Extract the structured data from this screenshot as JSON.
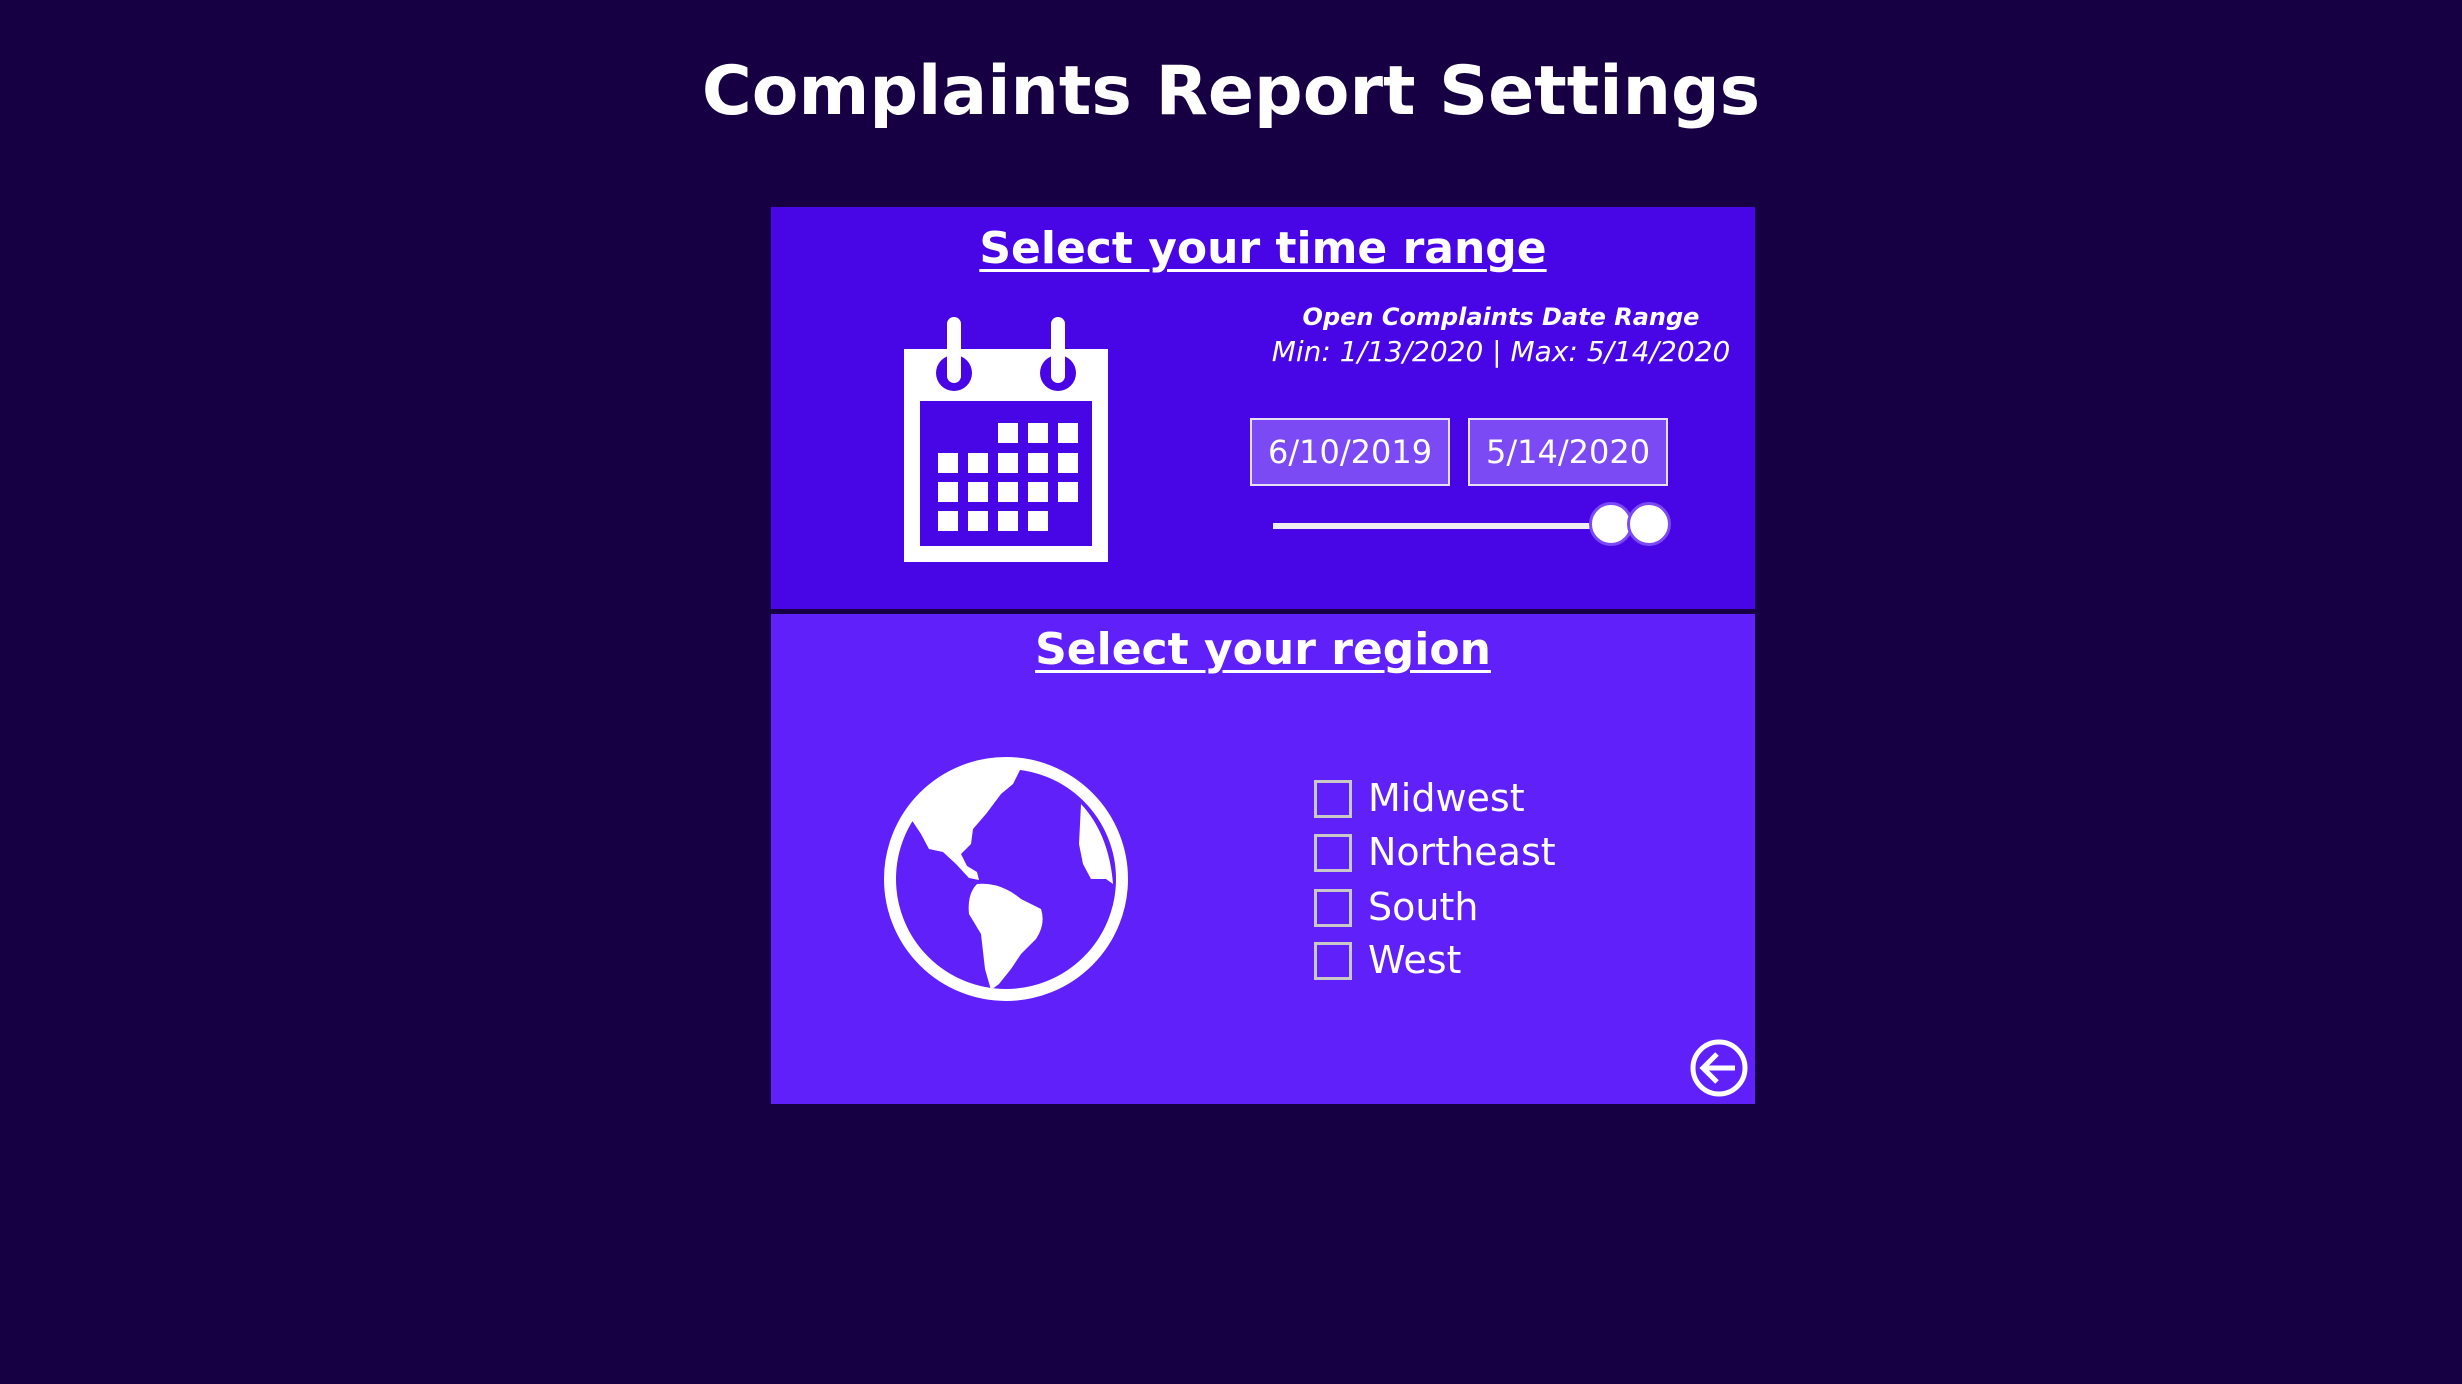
{
  "page": {
    "title": "Complaints Report Settings"
  },
  "time_range": {
    "heading": "Select your time range",
    "icon": "calendar-icon",
    "range_label": "Open Complaints Date Range",
    "range_minmax": "Min: 1/13/2020 | Max: 5/14/2020",
    "start_date": "6/10/2019",
    "end_date": "5/14/2020",
    "slider_start_fraction": 0.93,
    "slider_end_fraction": 1.0
  },
  "region": {
    "heading": "Select your region",
    "icon": "globe-icon",
    "options": [
      {
        "label": "Midwest",
        "checked": false
      },
      {
        "label": "Northeast",
        "checked": false
      },
      {
        "label": "South",
        "checked": false
      },
      {
        "label": "West",
        "checked": false
      }
    ]
  },
  "nav": {
    "back_icon": "back-arrow-circle-icon"
  },
  "colors": {
    "background": "#160043",
    "time_panel": "#4806E6",
    "region_panel": "#6020FA",
    "date_box": "#7B4AF5"
  }
}
